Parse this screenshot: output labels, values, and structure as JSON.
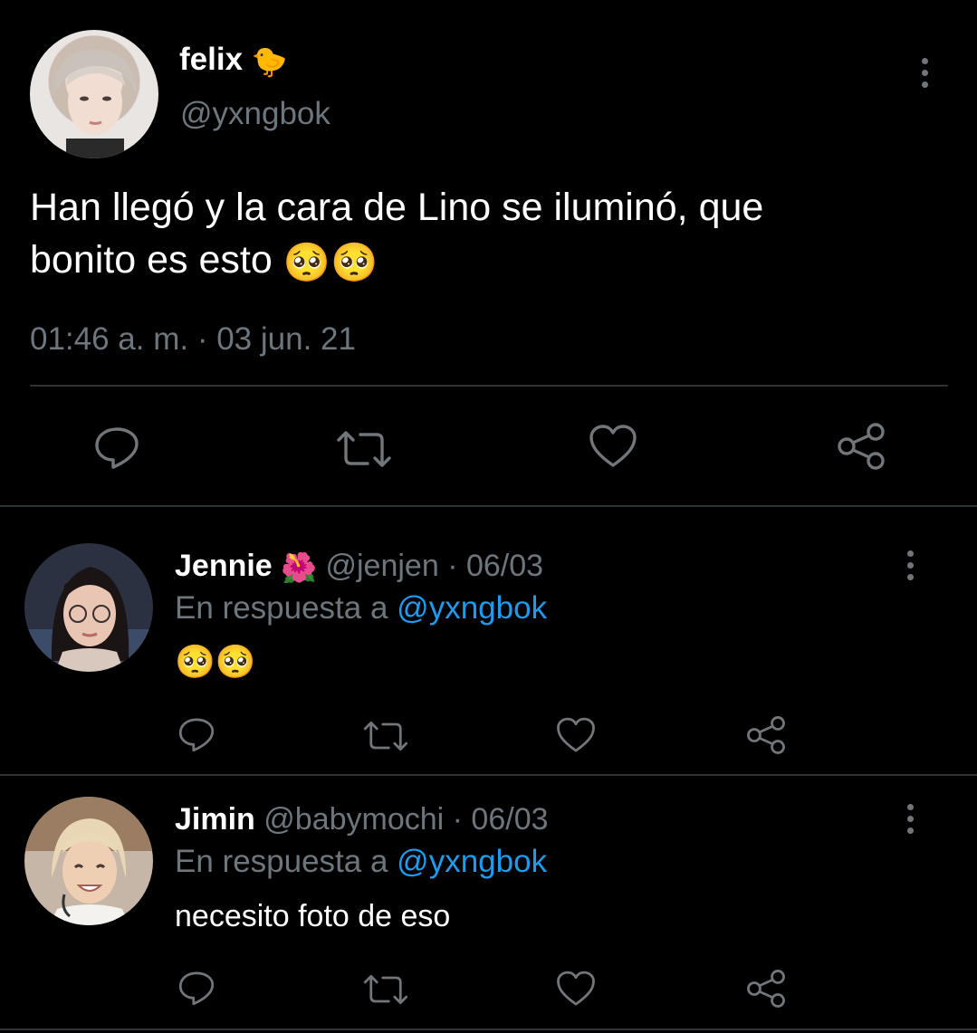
{
  "main_tweet": {
    "display_name": "felix",
    "name_emoji": "🐤",
    "handle": "@yxngbok",
    "text_line1": "Han llegó y la cara de Lino se iluminó, que",
    "text_line2": "bonito es esto",
    "text_emoji": "🥺🥺",
    "timestamp": "01:46 a. m. · 03 jun. 21",
    "icons": [
      "reply-icon",
      "retweet-icon",
      "like-icon",
      "share-icon"
    ]
  },
  "replies": [
    {
      "display_name": "Jennie",
      "name_emoji": "🌺",
      "handle": "@jenjen",
      "date": "· 06/03",
      "reply_prefix": "En respuesta a",
      "reply_to": "@yxngbok",
      "text": "🥺🥺"
    },
    {
      "display_name": "Jimin",
      "name_emoji": "",
      "handle": "@babymochi",
      "date": "· 06/03",
      "reply_prefix": "En respuesta a",
      "reply_to": "@yxngbok",
      "text": "necesito foto de eso"
    }
  ],
  "colors": {
    "background": "#000000",
    "muted": "#6e767d",
    "link": "#1d9bf0",
    "divider": "#2f3336"
  }
}
